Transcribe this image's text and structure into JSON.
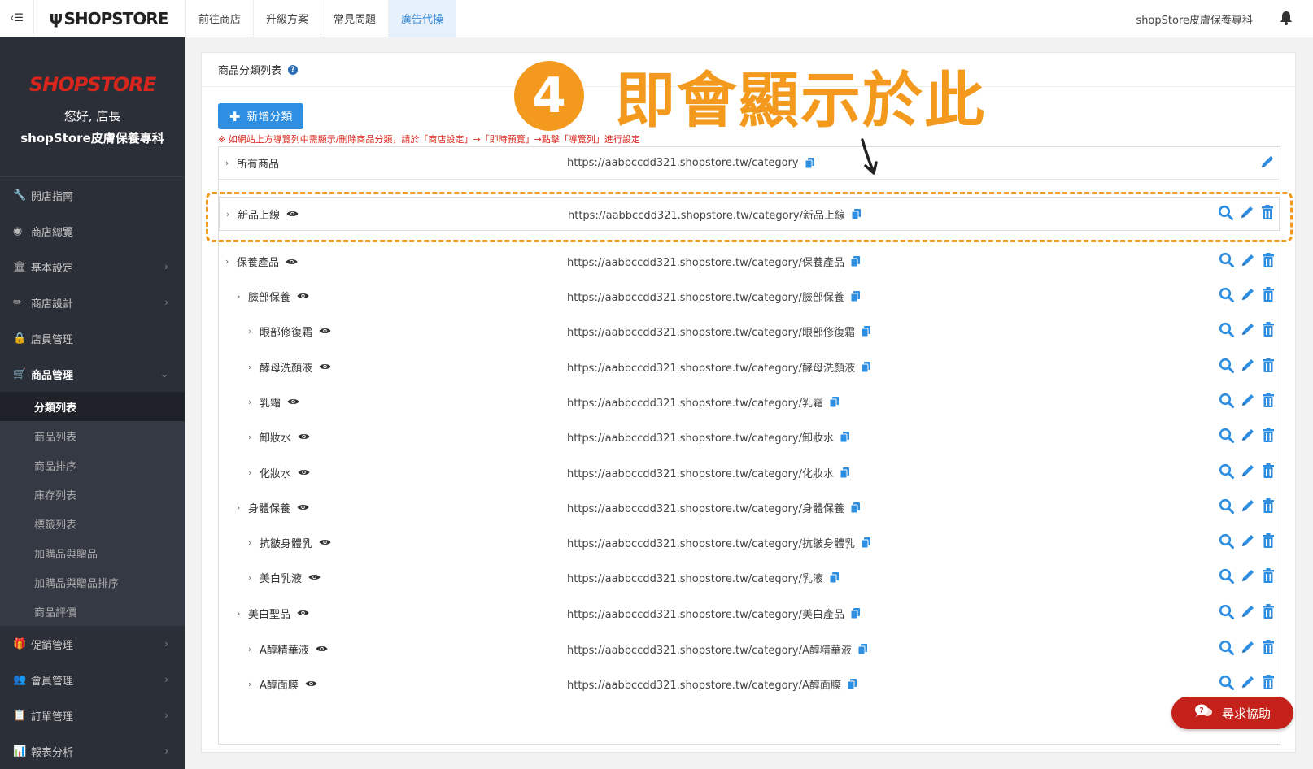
{
  "topbar": {
    "logo": "SHOPSTORE",
    "nav": [
      "前往商店",
      "升級方案",
      "常見問題",
      "廣告代操"
    ],
    "active_nav": "廣告代操",
    "store_name": "shopStore皮膚保養專科"
  },
  "sidebar": {
    "logo": "SHOPSTORE",
    "greeting": "您好, 店長",
    "store_name": "shopStore皮膚保養專科",
    "menu": [
      {
        "label": "開店指南",
        "icon": "wrench-icon"
      },
      {
        "label": "商店總覽",
        "icon": "dashboard-icon"
      },
      {
        "label": "基本設定",
        "icon": "bank-icon"
      },
      {
        "label": "商店設計",
        "icon": "magic-wand-icon"
      },
      {
        "label": "店員管理",
        "icon": "lock-icon"
      },
      {
        "label": "商品管理",
        "icon": "cart-icon"
      }
    ],
    "submenu": [
      "分類列表",
      "商品列表",
      "商品排序",
      "庫存列表",
      "標籤列表",
      "加購品與贈品",
      "加購品與贈品排序",
      "商品評價"
    ],
    "menu_after": [
      {
        "label": "促銷管理",
        "icon": "gift-icon"
      },
      {
        "label": "會員管理",
        "icon": "users-icon"
      },
      {
        "label": "訂單管理",
        "icon": "copy-icon"
      },
      {
        "label": "報表分析",
        "icon": "bar-chart-icon"
      }
    ]
  },
  "panel": {
    "title": "商品分類列表",
    "help": "?",
    "add_button": "新增分類",
    "notice": "※ 如網站上方導覽列中需顯示/刪除商品分類，請於「商店設定」→「即時預覽」→點擊「導覽列」進行設定"
  },
  "categories": [
    {
      "name": "所有商品",
      "url": "https://aabbccdd321.shopstore.tw/category",
      "indent": 0,
      "eye": false,
      "actions": "edit"
    },
    {
      "name": "新品上線",
      "url": "https://aabbccdd321.shopstore.tw/category/新品上線",
      "indent": 0,
      "eye": true,
      "actions": "all"
    },
    {
      "name": "保養產品",
      "url": "https://aabbccdd321.shopstore.tw/category/保養產品",
      "indent": 0,
      "eye": true,
      "actions": "all"
    },
    {
      "name": "臉部保養",
      "url": "https://aabbccdd321.shopstore.tw/category/臉部保養",
      "indent": 1,
      "eye": true,
      "actions": "all"
    },
    {
      "name": "眼部修復霜",
      "url": "https://aabbccdd321.shopstore.tw/category/眼部修復霜",
      "indent": 2,
      "eye": true,
      "actions": "all"
    },
    {
      "name": "酵母洗顏液",
      "url": "https://aabbccdd321.shopstore.tw/category/酵母洗顏液",
      "indent": 2,
      "eye": true,
      "actions": "all"
    },
    {
      "name": "乳霜",
      "url": "https://aabbccdd321.shopstore.tw/category/乳霜",
      "indent": 2,
      "eye": true,
      "actions": "all"
    },
    {
      "name": "卸妝水",
      "url": "https://aabbccdd321.shopstore.tw/category/卸妝水",
      "indent": 2,
      "eye": true,
      "actions": "all"
    },
    {
      "name": "化妝水",
      "url": "https://aabbccdd321.shopstore.tw/category/化妝水",
      "indent": 2,
      "eye": true,
      "actions": "all"
    },
    {
      "name": "身體保養",
      "url": "https://aabbccdd321.shopstore.tw/category/身體保養",
      "indent": 1,
      "eye": true,
      "actions": "all"
    },
    {
      "name": "抗皺身體乳",
      "url": "https://aabbccdd321.shopstore.tw/category/抗皺身體乳",
      "indent": 2,
      "eye": true,
      "actions": "all"
    },
    {
      "name": "美白乳液",
      "url": "https://aabbccdd321.shopstore.tw/category/乳液",
      "indent": 2,
      "eye": true,
      "actions": "all"
    },
    {
      "name": "美白聖品",
      "url": "https://aabbccdd321.shopstore.tw/category/美白產品",
      "indent": 1,
      "eye": true,
      "actions": "all"
    },
    {
      "name": "A醇精華液",
      "url": "https://aabbccdd321.shopstore.tw/category/A醇精華液",
      "indent": 2,
      "eye": true,
      "actions": "all"
    },
    {
      "name": "A醇面膜",
      "url": "https://aabbccdd321.shopstore.tw/category/A醇面膜",
      "indent": 2,
      "eye": true,
      "actions": "all"
    }
  ],
  "annotation": {
    "number": "4",
    "text": "即會顯示於此"
  },
  "help_button": "尋求協助",
  "colors": {
    "accent": "#2d8ee2",
    "highlight": "#f39a1e",
    "sidebar": "#2b2f38",
    "danger": "#c4211a"
  }
}
